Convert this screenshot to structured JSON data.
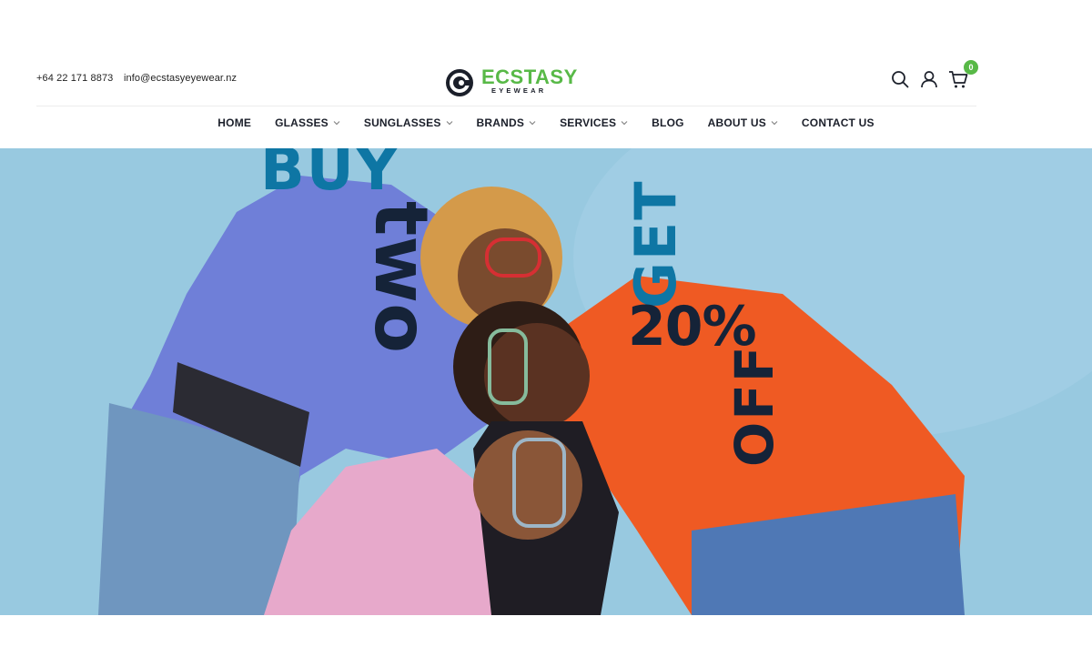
{
  "header": {
    "phone": "+64 22 171 8873",
    "email": "info@ecstasyeyewear.nz",
    "logo": {
      "name": "ECSTASY",
      "sub": "EYEWEAR"
    },
    "icons": [
      "search-icon",
      "user-icon",
      "cart-icon"
    ],
    "cart_count": "0"
  },
  "nav": {
    "items": [
      {
        "label": "HOME",
        "has_dropdown": false
      },
      {
        "label": "GLASSES",
        "has_dropdown": true
      },
      {
        "label": "SUNGLASSES",
        "has_dropdown": true
      },
      {
        "label": "BRANDS",
        "has_dropdown": true
      },
      {
        "label": "SERVICES",
        "has_dropdown": true
      },
      {
        "label": "BLOG",
        "has_dropdown": false
      },
      {
        "label": "ABOUT US",
        "has_dropdown": true
      },
      {
        "label": "CONTACT US",
        "has_dropdown": false
      }
    ]
  },
  "hero": {
    "promo_buy": "BUY",
    "promo_two": "two",
    "promo_get": "GET",
    "promo_percent": "20%",
    "promo_off": "OFF"
  },
  "colors": {
    "brand_green": "#58b947",
    "dark_navy": "#152338",
    "promo_blue": "#0e76a4",
    "hero_bg": "#98c9e0"
  }
}
